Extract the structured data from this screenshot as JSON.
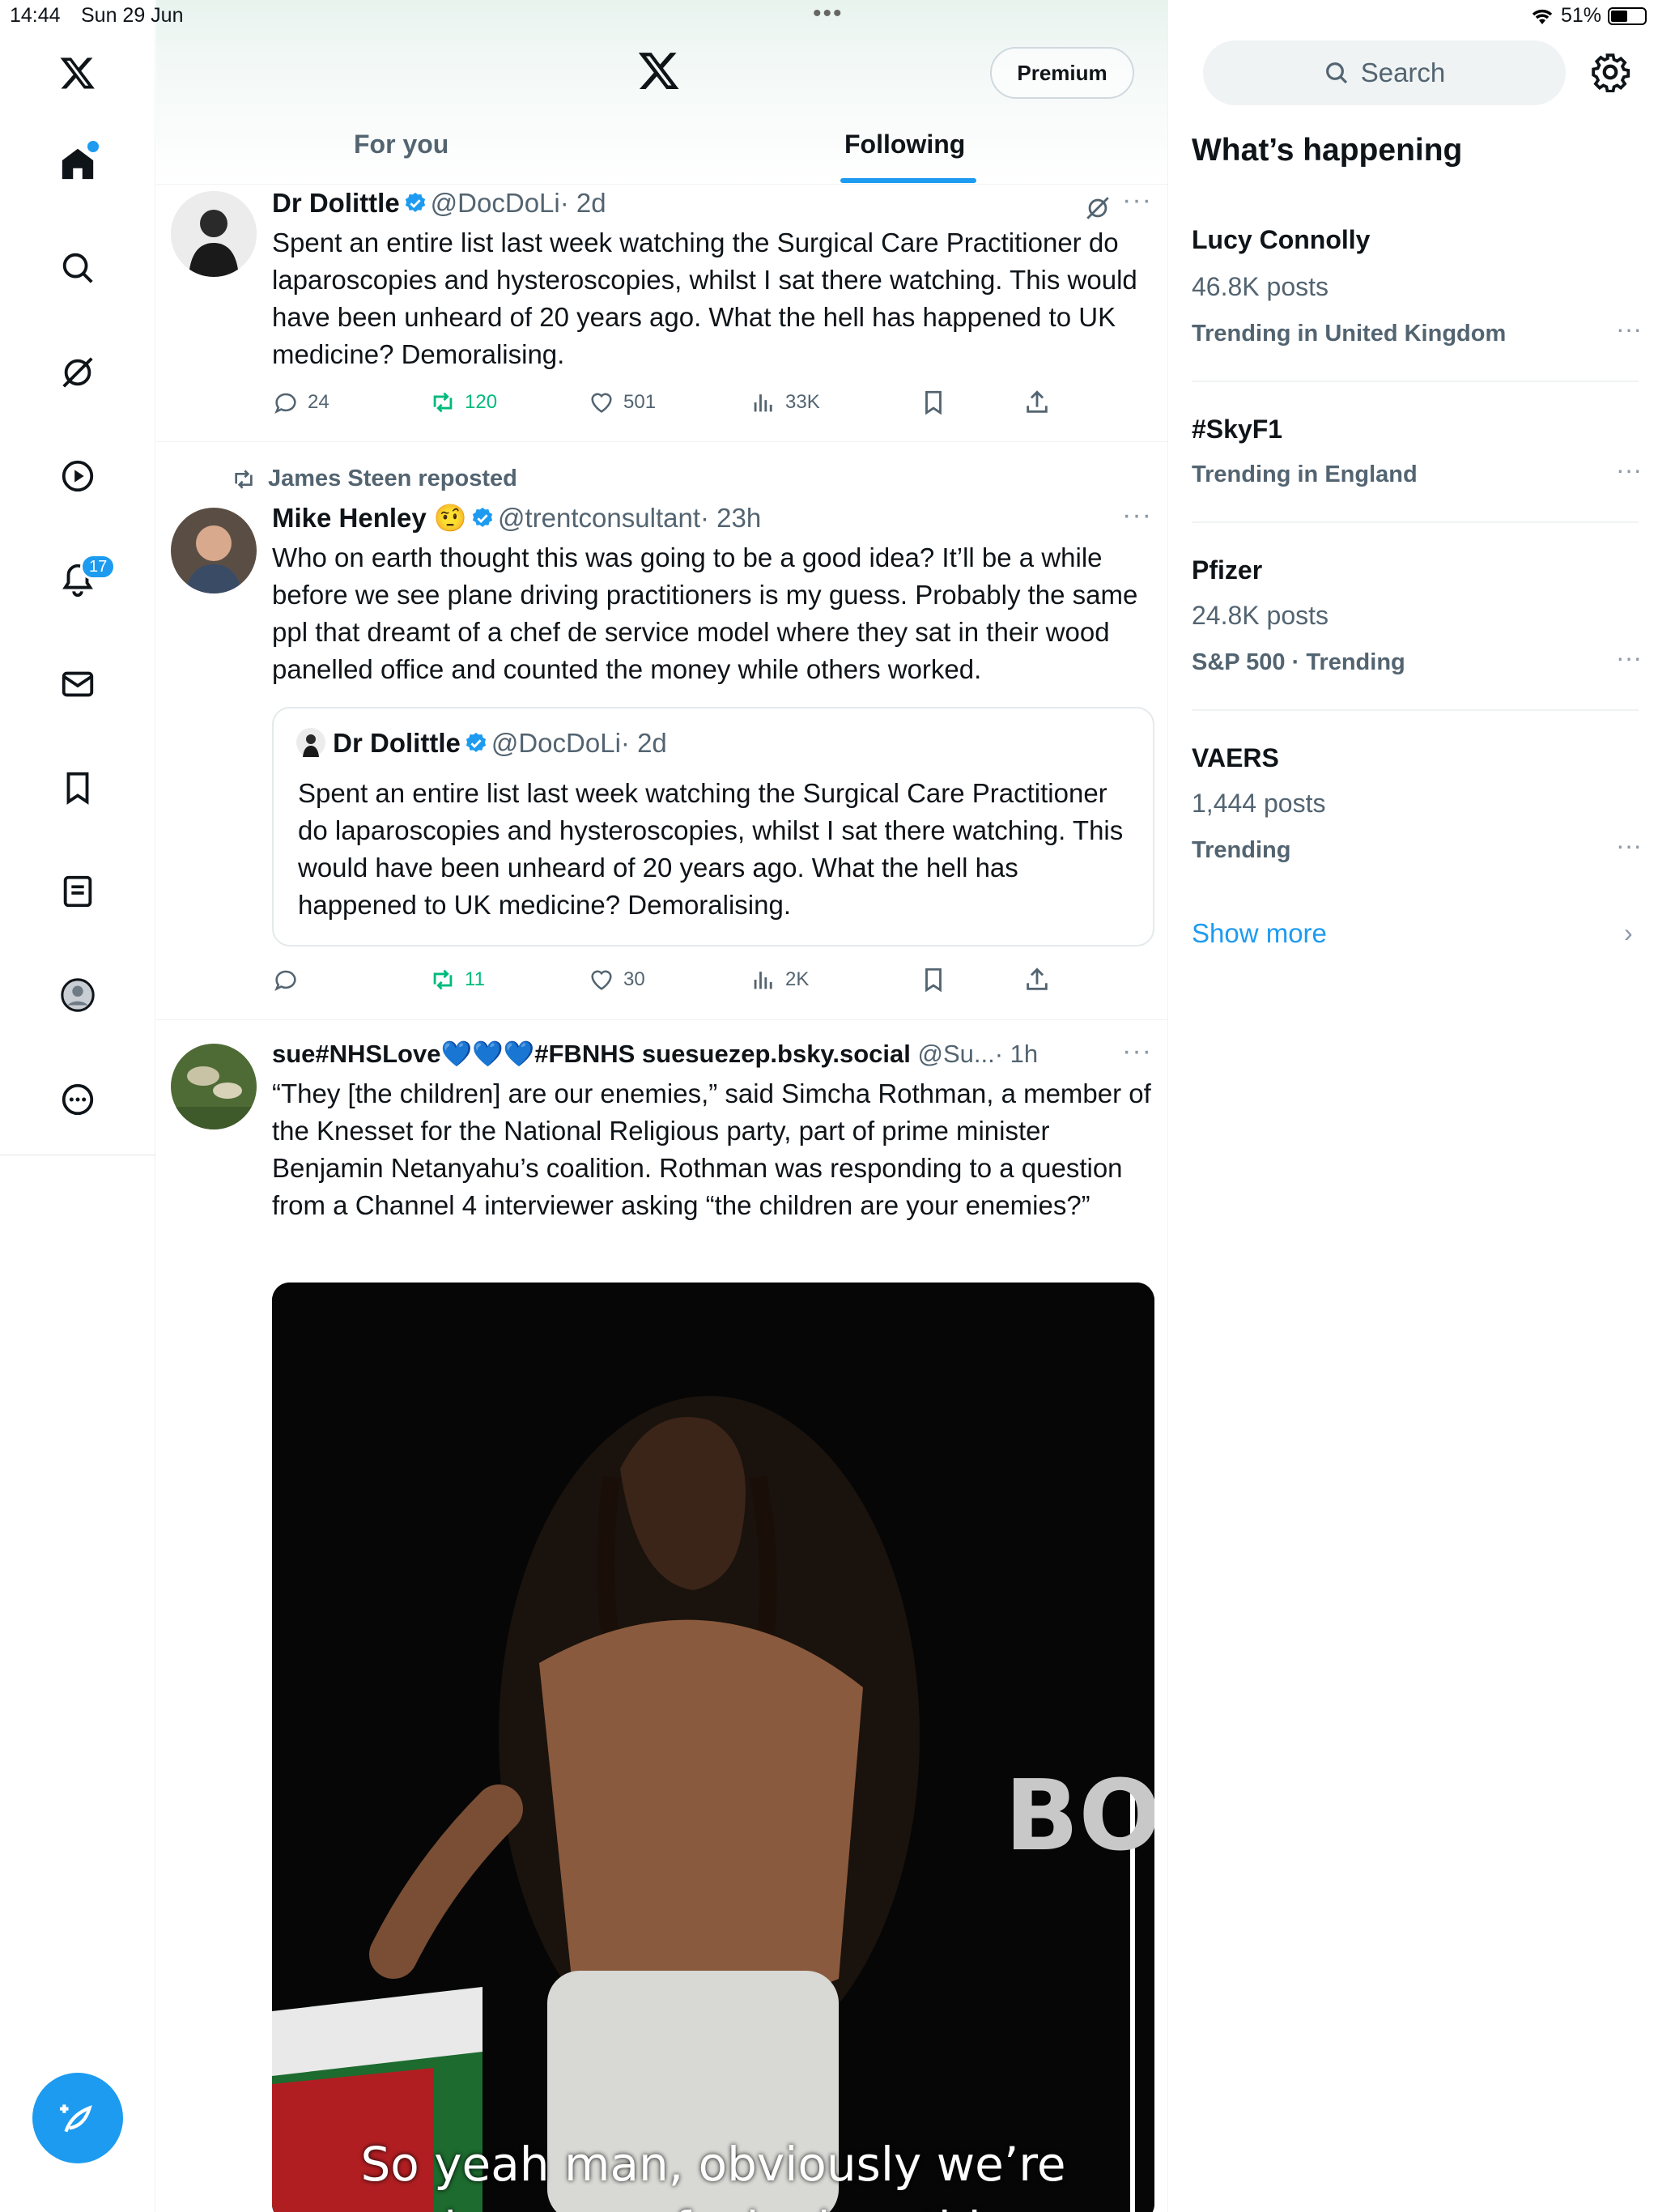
{
  "status_bar": {
    "time": "14:44",
    "date": "Sun 29 Jun",
    "battery": "51%",
    "battery_level": 0.51,
    "wifi_icon": "wifi-icon"
  },
  "nav": {
    "notification_count": "17",
    "items": [
      "x-logo",
      "home-icon",
      "search-icon",
      "grok-icon",
      "video-icon",
      "bell-icon",
      "mail-icon",
      "bookmark-icon",
      "list-icon",
      "profile-icon",
      "more-icon"
    ]
  },
  "header": {
    "premium_label": "Premium"
  },
  "tabs": [
    {
      "label": "For you",
      "active": false
    },
    {
      "label": "Following",
      "active": true
    }
  ],
  "tweets": [
    {
      "name": "Dr Dolittle",
      "handle": "@DocDoLi",
      "time": "· 2d",
      "text": "Spent an entire list last week watching the Surgical Care Practitioner do laparoscopies and hysteroscopies, whilst I sat there watching. This would have been unheard of 20 years ago. What the hell has happened to UK medicine? Demoralising.",
      "replies": "24",
      "reposts": "120",
      "likes": "501",
      "views": "33K"
    },
    {
      "reposted_by": "James Steen reposted",
      "name": "Mike Henley",
      "emoji": "🤨",
      "handle": "@trentconsultant",
      "time": "· 23h",
      "text": "Who on earth thought this was going to be a good idea? It’ll be a while before we see plane driving practitioners is my guess. Probably the same ppl that dreamt of a chef de service model where they sat in their wood panelled office and counted the money while others worked.",
      "quote": {
        "name": "Dr Dolittle",
        "handle": "@DocDoLi",
        "time": "· 2d",
        "text": "Spent an entire list last week watching the Surgical Care Practitioner do laparoscopies and hysteroscopies, whilst I sat there watching. This would have been unheard of 20 years ago. What the hell has happened to UK medicine? Demoralising."
      },
      "replies": "",
      "reposts": "11",
      "likes": "30",
      "views": "2K"
    },
    {
      "name": "sue#NHSLove💙💙💙#FBNHS suesuezep.bsky.social",
      "handle": "@Su...",
      "time": "· 1h",
      "text": "“They [the children] are our enemies,” said Simcha Rothman, a member of the Knesset for the National Religious party, part of prime minister Benjamin Netanyahu’s coalition. Rothman was responding to a question from a Channel 4 interviewer asking “the children are your enemies?”",
      "video_caption_1": "So yeah man, obviously we’re",
      "video_caption_2": "seeing some fucked up things",
      "video_sign": "BO"
    }
  ],
  "sidebar": {
    "search_placeholder": "Search",
    "title": "What’s happening",
    "trends": [
      {
        "name": "Lucy Connolly",
        "count": "46.8K posts",
        "meta": "Trending in United Kingdom"
      },
      {
        "name": "#SkyF1",
        "count": "",
        "meta": "Trending in England"
      },
      {
        "name": "Pfizer",
        "count": "24.8K posts",
        "meta": "S&P 500 · Trending"
      },
      {
        "name": "VAERS",
        "count": "1,444 posts",
        "meta": "Trending"
      }
    ],
    "show_more": "Show more"
  },
  "colors": {
    "accent": "#1d9bf0",
    "repost_green": "#00ba7c",
    "muted": "#536471"
  }
}
